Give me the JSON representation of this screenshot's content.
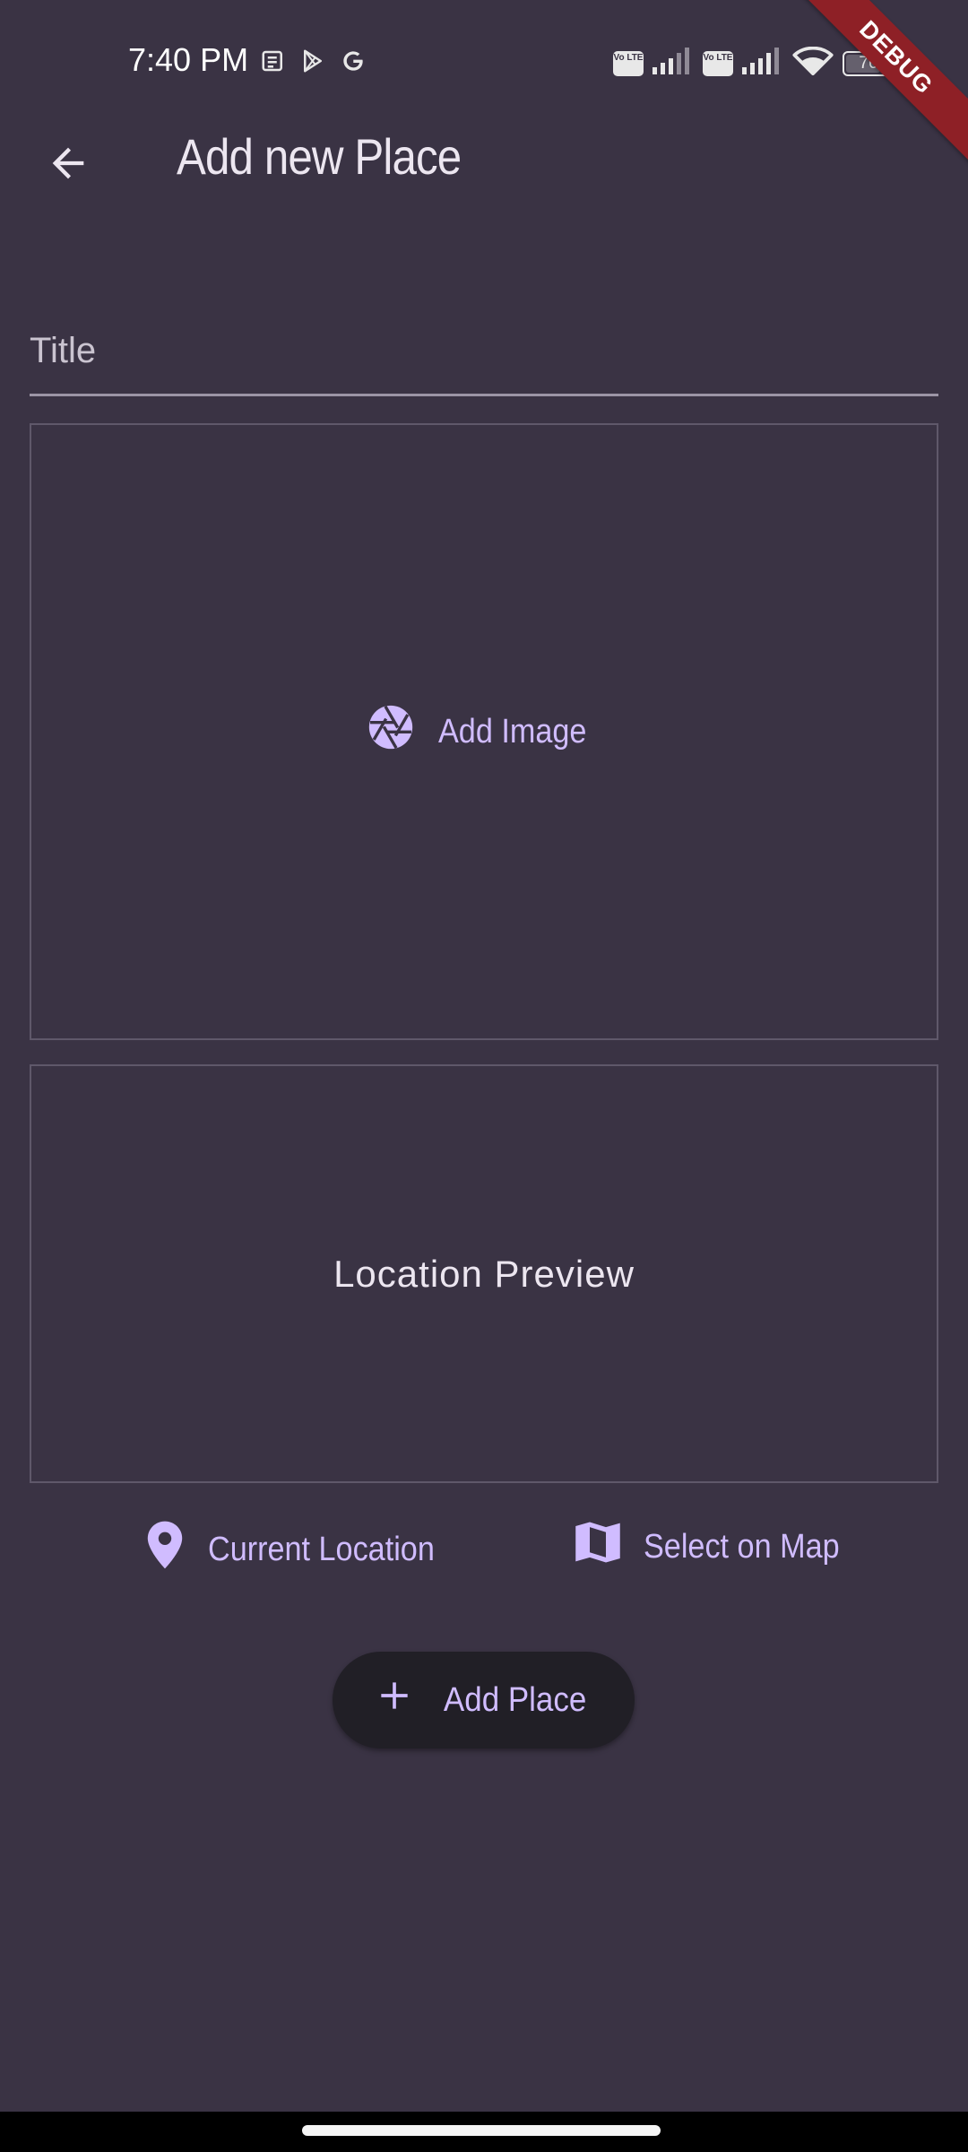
{
  "status_bar": {
    "time": "7:40 PM",
    "left_icons": [
      "news-icon",
      "play-store-icon",
      "google-icon"
    ],
    "right_icons": [
      "volte-icon",
      "signal-icon",
      "volte-icon",
      "signal-icon",
      "wifi-icon",
      "battery-icon"
    ],
    "volte_label": "Vo LTE",
    "battery_level": "76"
  },
  "debug_banner": "DEBUG",
  "app_bar": {
    "back_icon": "arrow-back-icon",
    "title": "Add new Place"
  },
  "form": {
    "title_placeholder": "Title",
    "title_value": ""
  },
  "image_picker": {
    "icon": "camera-aperture-icon",
    "label": "Add Image"
  },
  "location": {
    "preview_text": "Location Preview",
    "current_location": {
      "icon": "location-pin-icon",
      "label": "Current Location"
    },
    "select_on_map": {
      "icon": "map-icon",
      "label": "Select on Map"
    }
  },
  "add_place_button": {
    "icon": "plus-icon",
    "label": "Add Place"
  },
  "colors": {
    "background": "#3a3344",
    "accent": "#d0bcff",
    "button_bg": "#211f26",
    "debug": "#8e2026"
  }
}
